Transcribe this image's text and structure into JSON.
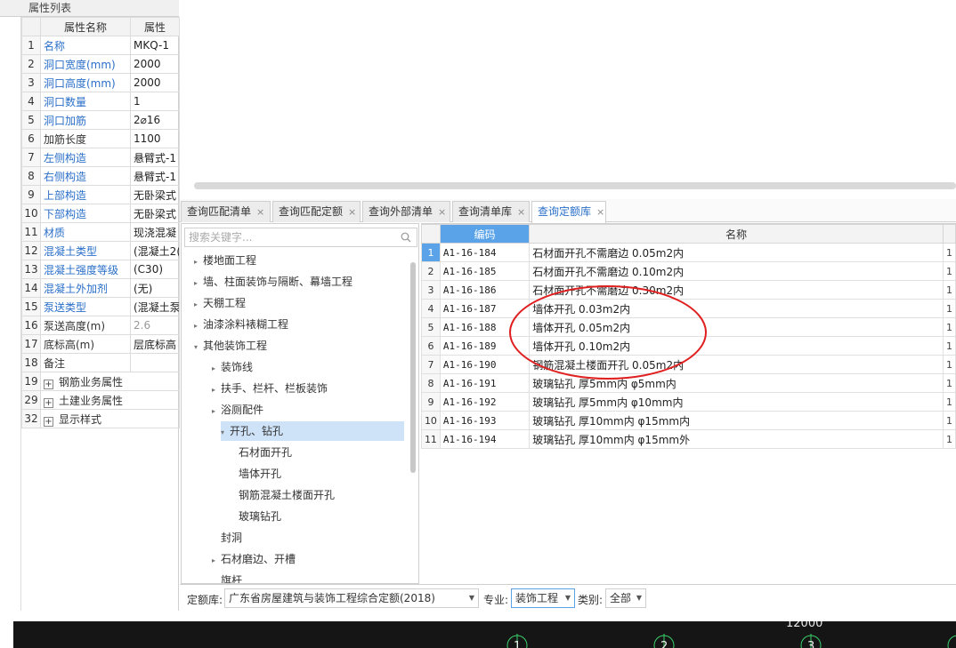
{
  "prop_panel": {
    "title": "属性列表",
    "col_name": "属性名称",
    "col_value": "属性",
    "rows": [
      {
        "num": "1",
        "name": "名称",
        "value": "MKQ-1",
        "blue": true
      },
      {
        "num": "2",
        "name": "洞口宽度(mm)",
        "value": "2000",
        "blue": true
      },
      {
        "num": "3",
        "name": "洞口高度(mm)",
        "value": "2000",
        "blue": true
      },
      {
        "num": "4",
        "name": "洞口数量",
        "value": "1",
        "blue": true
      },
      {
        "num": "5",
        "name": "洞口加筋",
        "value": "2⌀16",
        "blue": true
      },
      {
        "num": "6",
        "name": "加筋长度",
        "value": "1100",
        "blue": false
      },
      {
        "num": "7",
        "name": "左侧构造",
        "value": "悬臂式-1",
        "blue": true
      },
      {
        "num": "8",
        "name": "右侧构造",
        "value": "悬臂式-1",
        "blue": true
      },
      {
        "num": "9",
        "name": "上部构造",
        "value": "无卧梁式",
        "blue": true
      },
      {
        "num": "10",
        "name": "下部构造",
        "value": "无卧梁式",
        "blue": true
      },
      {
        "num": "11",
        "name": "材质",
        "value": "现浇混凝",
        "blue": true
      },
      {
        "num": "12",
        "name": "混凝土类型",
        "value": "(混凝土2(",
        "blue": true
      },
      {
        "num": "13",
        "name": "混凝土强度等级",
        "value": "(C30)",
        "blue": true
      },
      {
        "num": "14",
        "name": "混凝土外加剂",
        "value": "(无)",
        "blue": true
      },
      {
        "num": "15",
        "name": "泵送类型",
        "value": "(混凝土泵",
        "blue": true
      },
      {
        "num": "16",
        "name": "泵送高度(m)",
        "value": "2.6",
        "blue": false,
        "gray": true
      },
      {
        "num": "17",
        "name": "底标高(m)",
        "value": "层底标高",
        "blue": false
      },
      {
        "num": "18",
        "name": "备注",
        "value": "",
        "blue": false
      }
    ],
    "groups": [
      {
        "num": "19",
        "name": "钢筋业务属性"
      },
      {
        "num": "29",
        "name": "土建业务属性"
      },
      {
        "num": "32",
        "name": "显示样式"
      }
    ]
  },
  "tabs": [
    {
      "label": "查询匹配清单",
      "close": "×"
    },
    {
      "label": "查询匹配定额",
      "close": "×"
    },
    {
      "label": "查询外部清单",
      "close": "×"
    },
    {
      "label": "查询清单库",
      "close": "×"
    },
    {
      "label": "查询定额库",
      "close": "×",
      "active": true
    }
  ],
  "tree": {
    "search_placeholder": "搜索关键字...",
    "nodes": [
      {
        "label": "楼地面工程",
        "arrow": "▸",
        "level": 0
      },
      {
        "label": "墙、柱面装饰与隔断、幕墙工程",
        "arrow": "▸",
        "level": 0
      },
      {
        "label": "天棚工程",
        "arrow": "▸",
        "level": 0
      },
      {
        "label": "油漆涂料裱糊工程",
        "arrow": "▸",
        "level": 0
      },
      {
        "label": "其他装饰工程",
        "arrow": "▾",
        "level": 0
      },
      {
        "label": "装饰线",
        "arrow": "▸",
        "level": 1
      },
      {
        "label": "扶手、栏杆、栏板装饰",
        "arrow": "▸",
        "level": 1
      },
      {
        "label": "浴厕配件",
        "arrow": "▸",
        "level": 1
      },
      {
        "label": "开孔、钻孔",
        "arrow": "▾",
        "level": 1,
        "selected": true
      },
      {
        "label": "石材面开孔",
        "arrow": "",
        "level": 2
      },
      {
        "label": "墙体开孔",
        "arrow": "",
        "level": 2
      },
      {
        "label": "钢筋混凝土楼面开孔",
        "arrow": "",
        "level": 2
      },
      {
        "label": "玻璃钻孔",
        "arrow": "",
        "level": 2
      },
      {
        "label": "封洞",
        "arrow": "",
        "level": 1
      },
      {
        "label": "石材磨边、开槽",
        "arrow": "▸",
        "level": 1
      },
      {
        "label": "旗杆",
        "arrow": "",
        "level": 1
      }
    ]
  },
  "grid": {
    "col_code": "编码",
    "col_name": "名称",
    "rows": [
      {
        "num": "1",
        "code": "A1-16-184",
        "name": "石材面开孔不需磨边 0.05m2内",
        "extra": "1"
      },
      {
        "num": "2",
        "code": "A1-16-185",
        "name": "石材面开孔不需磨边 0.10m2内",
        "extra": "1"
      },
      {
        "num": "3",
        "code": "A1-16-186",
        "name": "石材面开孔不需磨边 0.30m2内",
        "extra": "1"
      },
      {
        "num": "4",
        "code": "A1-16-187",
        "name": "墙体开孔 0.03m2内",
        "extra": "1"
      },
      {
        "num": "5",
        "code": "A1-16-188",
        "name": "墙体开孔 0.05m2内",
        "extra": "1"
      },
      {
        "num": "6",
        "code": "A1-16-189",
        "name": "墙体开孔 0.10m2内",
        "extra": "1"
      },
      {
        "num": "7",
        "code": "A1-16-190",
        "name": "钢筋混凝土楼面开孔 0.05m2内",
        "extra": "1"
      },
      {
        "num": "8",
        "code": "A1-16-191",
        "name": "玻璃钻孔 厚5mm内 φ5mm内",
        "extra": "1"
      },
      {
        "num": "9",
        "code": "A1-16-192",
        "name": "玻璃钻孔 厚5mm内 φ10mm内",
        "extra": "1"
      },
      {
        "num": "10",
        "code": "A1-16-193",
        "name": "玻璃钻孔 厚10mm内 φ15mm内",
        "extra": "1"
      },
      {
        "num": "11",
        "code": "A1-16-194",
        "name": "玻璃钻孔 厚10mm内 φ15mm外",
        "extra": "1"
      }
    ]
  },
  "filter": {
    "quota_label": "定额库:",
    "quota_value": "广东省房屋建筑与装饰工程综合定额(2018)",
    "major_label": "专业:",
    "major_value": "装饰工程",
    "category_label": "类别:",
    "category_value": "全部"
  },
  "canvas": {
    "dimension_text": "12000",
    "axis_labels": [
      "1",
      "2",
      "3"
    ]
  },
  "colors": {
    "accent": "#5aa3e8",
    "link_blue": "#2a6fc9",
    "annotation_red": "#e02020"
  }
}
